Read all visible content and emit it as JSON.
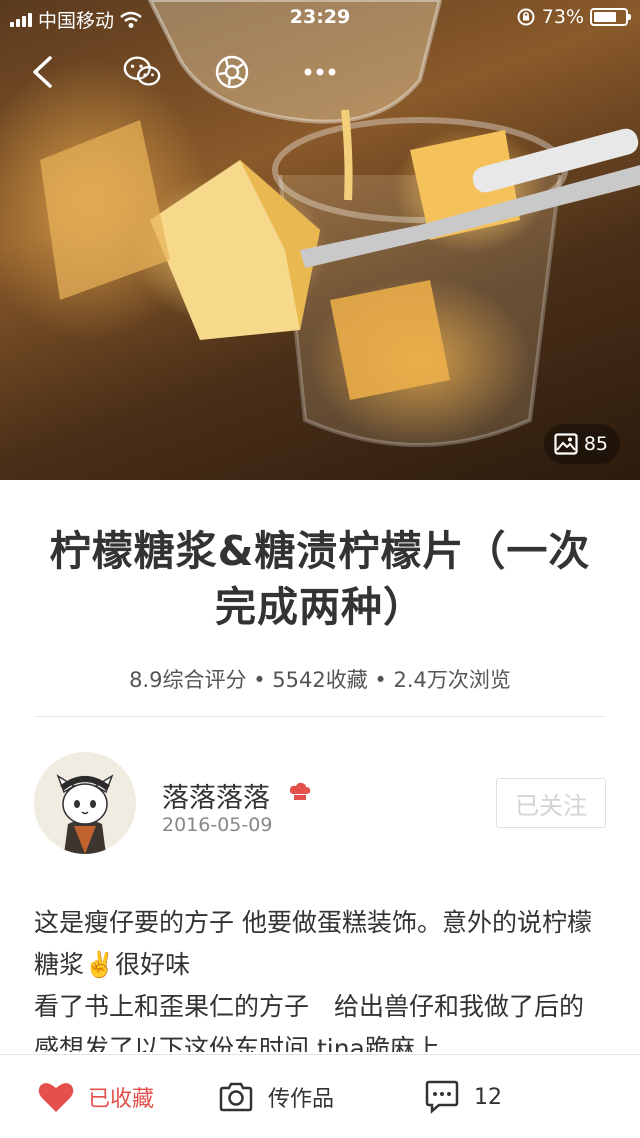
{
  "status_bar": {
    "carrier": "中国移动",
    "time": "23:29",
    "battery_percent": "73%",
    "battery_level": 0.73
  },
  "nav": {
    "icons": [
      "back-icon",
      "wechat-icon",
      "moments-icon",
      "more-icon"
    ]
  },
  "hero": {
    "image_count": "85"
  },
  "recipe": {
    "title": "柠檬糖浆&糖渍柠檬片（一次完成两种）",
    "stats": "8.9综合评分 • 5542收藏 • 2.4万次浏览"
  },
  "author": {
    "name": "落落落落",
    "date": "2016-05-09",
    "follow_label": "已关注"
  },
  "intro": {
    "line1": "这是瘦仔要的方子 他要做蛋糕装饰。意外的说柠檬糖浆✌️很好味",
    "line2": "看了书上和歪果仁的方子　给出兽仔和我做了后的感想发了以下这份东时间 tina跪麻上"
  },
  "bottom_bar": {
    "favorite_label": "已收藏",
    "upload_label": "传作品",
    "comment_count": "12"
  },
  "colors": {
    "accent": "#e4504b",
    "text": "#333333",
    "muted": "#888888"
  }
}
